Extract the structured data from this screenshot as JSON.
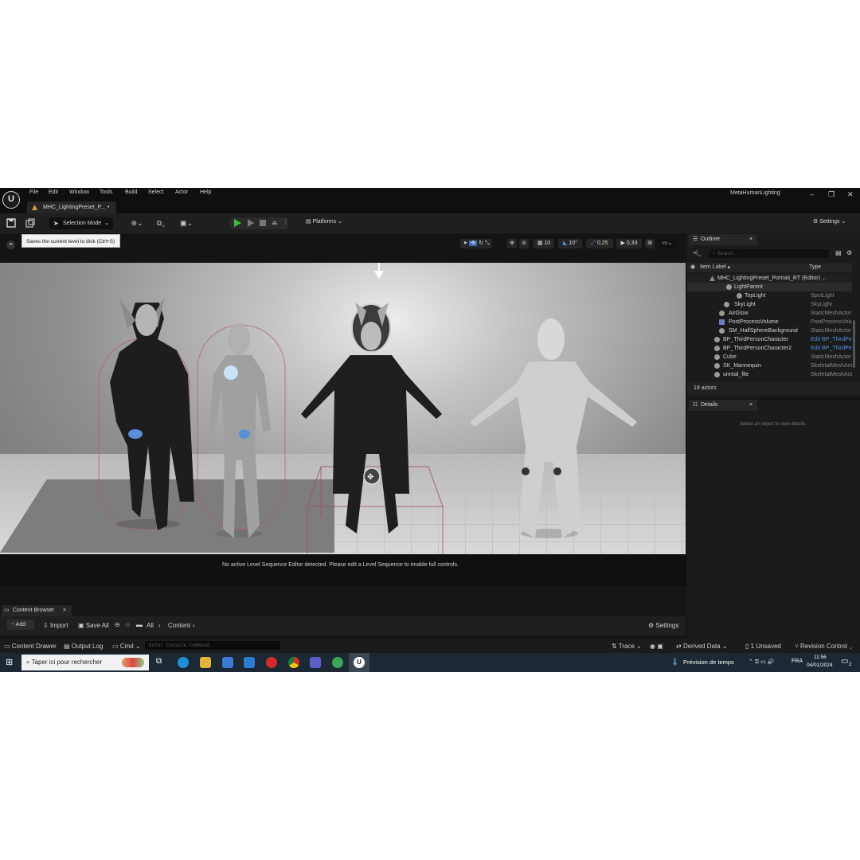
{
  "app": {
    "logo": "U",
    "menu": [
      "File",
      "Edit",
      "Window",
      "Tools",
      "Build",
      "Select",
      "Actor",
      "Help"
    ],
    "level_tab": "MHC_LightingPreset_P...",
    "level_tab_dot": "•",
    "project_name": "MetaHumanLighting",
    "window_controls": [
      "–",
      "❐",
      "✕"
    ]
  },
  "toolbar": {
    "selection_mode": "Selection Mode",
    "platforms": "Platforms",
    "settings": "Settings",
    "tooltip": "Saves the current level to disk (Ctrl+S)"
  },
  "viewport": {
    "grid_snap": "10",
    "rotation_snap": "10°",
    "scale_snap": "0,25",
    "camera_speed": "0,33",
    "status_message": "No active Level Sequence Editor detected. Please edit a Level Sequence to enable full controls."
  },
  "outliner": {
    "title": "Outliner",
    "close": "×",
    "search_placeholder": "Search...",
    "col_label": "Item Label ▴",
    "col_type": "Type",
    "rows": [
      {
        "label": "MHC_LightingPreset_Portrait_RT (Editor) ...",
        "type": ""
      },
      {
        "label": "LightParent",
        "type": ""
      },
      {
        "label": "TopLight",
        "type": "SpotLight"
      },
      {
        "label": "SkyLight",
        "type": "SkyLight"
      },
      {
        "label": "AirGlow",
        "type": "StaticMeshActor"
      },
      {
        "label": "PostProcessVolume",
        "type": "PostProcessVolume"
      },
      {
        "label": "SM_HalfSphereBackground",
        "type": "StaticMeshActor"
      },
      {
        "label": "BP_ThirdPersonCharacter",
        "type": "Edit BP_ThirdPersonCharacter"
      },
      {
        "label": "BP_ThirdPersonCharacter2",
        "type": "Edit BP_ThirdPersonCharacter"
      },
      {
        "label": "Cube",
        "type": "StaticMeshActor"
      },
      {
        "label": "SK_Mannequin",
        "type": "SkeletalMeshActor"
      },
      {
        "label": "unreal_file",
        "type": "SkeletalMeshActor"
      }
    ],
    "actor_count": "19 actors"
  },
  "details": {
    "title": "Details",
    "close": "×",
    "empty_message": "Select an object to view details."
  },
  "content_browser": {
    "tab": "Content Browser",
    "add": "Add",
    "import": "Import",
    "save_all": "Save All",
    "path_all": "All",
    "path_content": "Content",
    "settings": "Settings"
  },
  "status_bar": {
    "content_drawer": "Content Drawer",
    "output_log": "Output Log",
    "cmd": "Cmd",
    "console_placeholder": "Enter Console Command",
    "trace": "Trace",
    "derived_data": "Derived Data",
    "unsaved": "1 Unsaved",
    "revision_control": "Revision Control"
  },
  "taskbar": {
    "search_text": "Taper ici pour rechercher",
    "weather": "Prévision de temps",
    "language": "FRA",
    "time": "11:56",
    "date": "04/01/2024",
    "notification_count": "2"
  },
  "colors": {
    "accent_blue": "#4f8fe0",
    "play_green": "#3bbf3b",
    "editor_bg": "#151515",
    "taskbar_bg": "#1c2833"
  }
}
